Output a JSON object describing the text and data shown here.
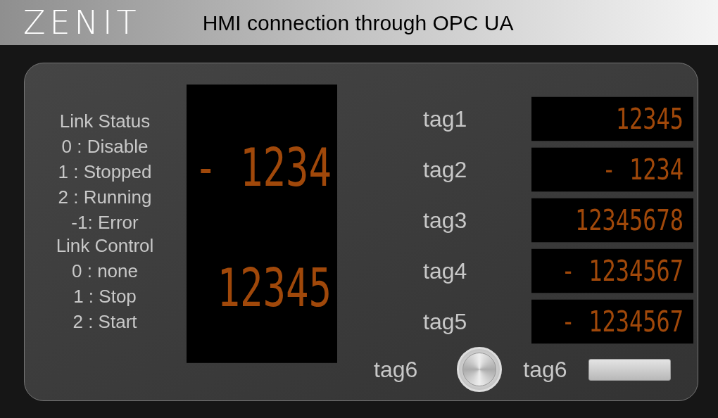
{
  "header": {
    "logo": "ZENIT",
    "title": "HMI connection through OPC UA"
  },
  "link_status": {
    "title": "Link Status",
    "options": [
      "0 : Disable",
      "1 : Stopped",
      "2 : Running",
      "-1: Error"
    ],
    "display": "- 1234"
  },
  "link_control": {
    "title": "Link Control",
    "options": [
      "0 : none",
      "1 : Stop",
      "2 : Start"
    ],
    "display": "12345"
  },
  "tags": [
    {
      "label": "tag1",
      "display": "12345"
    },
    {
      "label": "tag2",
      "display": "- 1234"
    },
    {
      "label": "tag3",
      "display": "12345678"
    },
    {
      "label": "tag4",
      "display": "- 1234567"
    },
    {
      "label": "tag5",
      "display": "- 1234567"
    }
  ],
  "bottom": {
    "button_label": "tag6",
    "indicator_label": "tag6"
  }
}
